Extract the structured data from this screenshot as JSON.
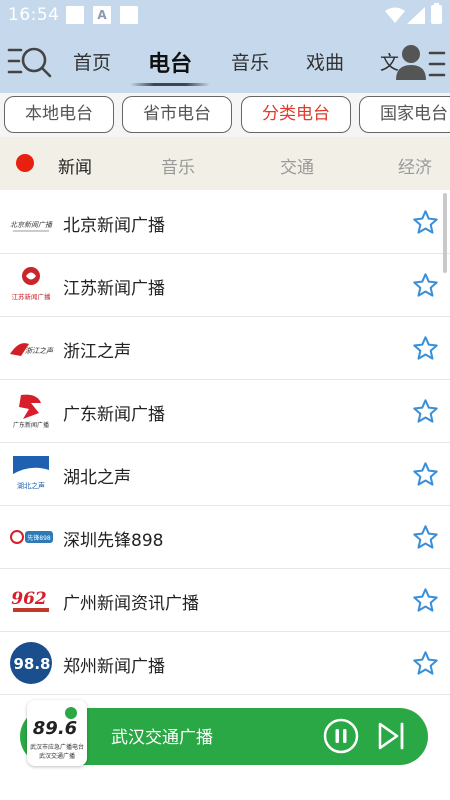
{
  "status": {
    "time": "16:54",
    "notif_letter": "A"
  },
  "nav": {
    "tabs": [
      {
        "label": "首页"
      },
      {
        "label": "电台"
      },
      {
        "label": "音乐"
      },
      {
        "label": "戏曲"
      },
      {
        "label": "文"
      }
    ],
    "active_index": 1
  },
  "categories": [
    {
      "label": "本地电台"
    },
    {
      "label": "省市电台"
    },
    {
      "label": "分类电台"
    },
    {
      "label": "国家电台"
    }
  ],
  "selected_category_index": 2,
  "subtabs": [
    {
      "label": "新闻"
    },
    {
      "label": "音乐"
    },
    {
      "label": "交通"
    },
    {
      "label": "经济"
    }
  ],
  "active_subtab_index": 0,
  "stations": [
    {
      "name": "北京新闻广播",
      "logo_text": "北京新闻广播"
    },
    {
      "name": "江苏新闻广播",
      "logo_text": "江苏新闻广播"
    },
    {
      "name": "浙江之声",
      "logo_text": "浙江之声"
    },
    {
      "name": "广东新闻广播",
      "logo_text": "广东新闻广播"
    },
    {
      "name": "湖北之声",
      "logo_text": "湖北之声"
    },
    {
      "name": "深圳先锋898",
      "logo_text": "先锋898"
    },
    {
      "name": "广州新闻资讯广播",
      "logo_text": "962"
    },
    {
      "name": "郑州新闻广播",
      "logo_text": "98.8"
    }
  ],
  "player": {
    "title": "武汉交通广播",
    "cover_text": "89.6",
    "cover_line1": "武汉市应急广播电台",
    "cover_line2": "武汉交通广播"
  },
  "colors": {
    "header_bg": "#c6d9ec",
    "accent_red": "#e03b2a",
    "star_blue": "#3a8fd9",
    "player_green": "#2aa845"
  },
  "icons": {
    "menu": "menu-search-icon",
    "profile": "profile-list-icon",
    "star": "star-outline-icon",
    "pause": "pause-circle-icon",
    "next": "skip-next-icon"
  }
}
